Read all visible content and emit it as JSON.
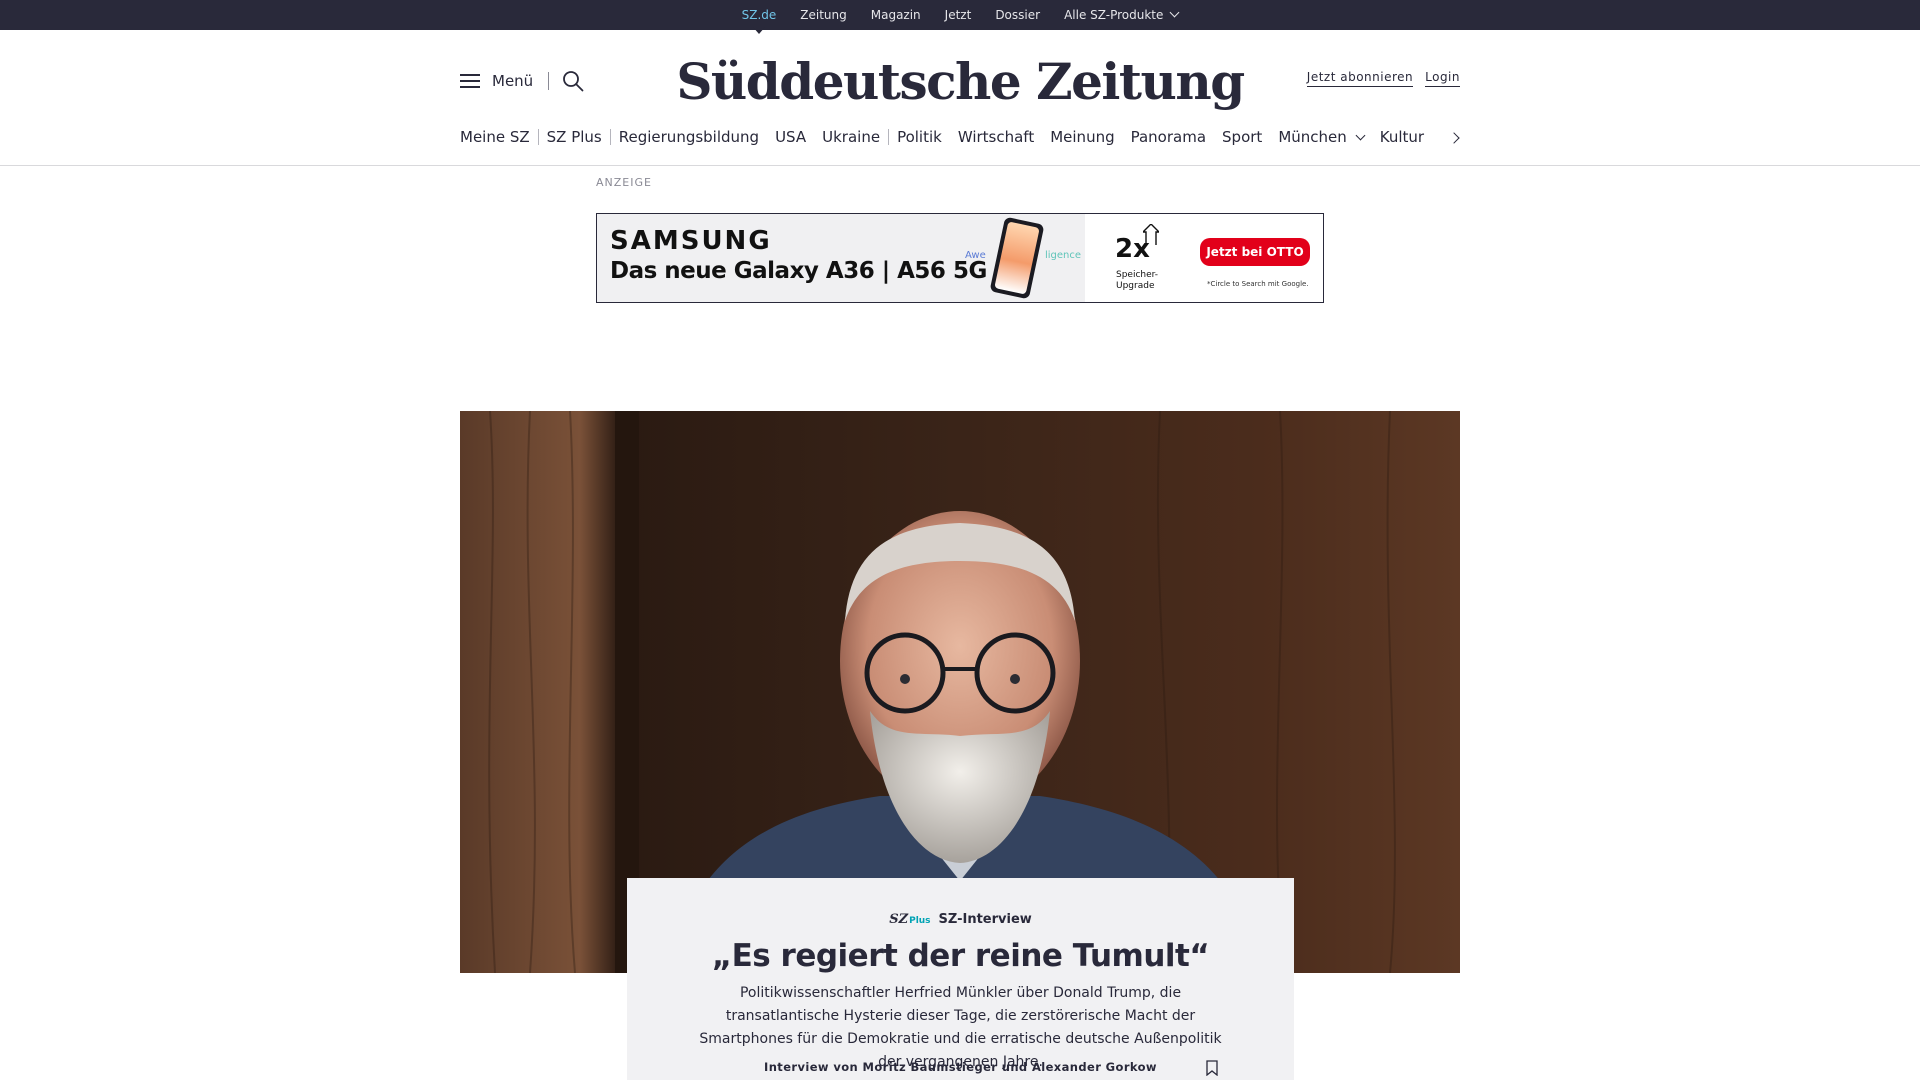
{
  "topbar": {
    "links": [
      "SZ.de",
      "Zeitung",
      "Magazin",
      "Jetzt",
      "Dossier"
    ],
    "products_label": "Alle SZ-Produkte",
    "accent_color": "#71c5e8"
  },
  "header": {
    "menu_label": "Menü",
    "logo_text": "Süddeutsche Zeitung",
    "subscribe_label": "Jetzt abonnieren",
    "login_label": "Login"
  },
  "nav": {
    "items": [
      "Meine SZ",
      "SZ Plus",
      "Regierungsbildung",
      "USA",
      "Ukraine",
      "Politik",
      "Wirtschaft",
      "Meinung",
      "Panorama",
      "Sport",
      "München",
      "Kultur"
    ]
  },
  "ad": {
    "label": "ANZEIGE",
    "brand": "SAMSUNG",
    "product": "Das neue Galaxy A36 | A56 5G",
    "left_word": "Awe",
    "right_word": "ligence",
    "upgrade_big": "2x",
    "upgrade_text": "Speicher-\nUpgrade",
    "cta": "Jetzt bei OTTO",
    "note": "*Circle to Search mit Google."
  },
  "article": {
    "badge_logo": "SZ",
    "badge_plus": "Plus",
    "kicker": "SZ-Interview",
    "title": "„Es regiert der reine Tumult“",
    "lead": "Politikwissenschaftler Herfried Münkler über Donald Trump, die transatlantische Hysterie dieser Tage, die zerstörerische Macht der Smartphones für die Demokratie und die erratische deutsche Außenpolitik der vergangenen Jahre.",
    "author": "Interview von Moritz Baumstieger und Alexander Gorkow"
  },
  "colors": {
    "topbar_bg": "#29293a",
    "ad_cta": "#e2001a",
    "plus_accent": "#00a3b4"
  }
}
